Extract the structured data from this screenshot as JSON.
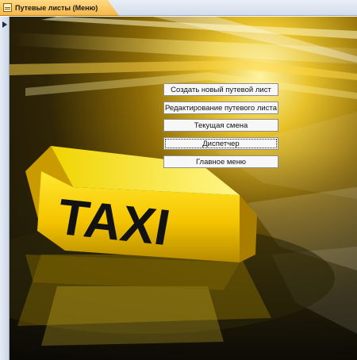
{
  "window": {
    "tab_title": "Путевые листы (Меню)",
    "tab_icon": "form-icon"
  },
  "form": {
    "background_sign_text": "TAXI",
    "accent_color": "#f5c400",
    "buttons": [
      {
        "label": "Создать новый путевой лист"
      },
      {
        "label": "Редактирование путевого листа"
      },
      {
        "label": "Текущая смена"
      },
      {
        "label": "Диспетчер",
        "focused": true
      },
      {
        "label": "Главное меню"
      }
    ]
  }
}
